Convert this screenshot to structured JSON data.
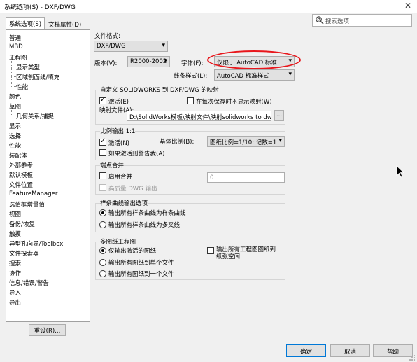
{
  "window": {
    "title": "系统选项(S) - DXF/DWG",
    "close_glyph": "✕"
  },
  "tabs": [
    {
      "label": "系统选项(S)"
    },
    {
      "label": "文档属性(D)"
    }
  ],
  "search": {
    "placeholder": "搜索选项"
  },
  "tree": [
    {
      "label": "普通"
    },
    {
      "label": "MBD"
    },
    {
      "label": "工程图"
    },
    {
      "label": "显示类型"
    },
    {
      "label": "区域剖面线/填充"
    },
    {
      "label": "性能"
    },
    {
      "label": "颜色"
    },
    {
      "label": "草图"
    },
    {
      "label": "几何关系/捕捉"
    },
    {
      "label": "显示"
    },
    {
      "label": "选择"
    },
    {
      "label": "性能"
    },
    {
      "label": "装配体"
    },
    {
      "label": "外部参考"
    },
    {
      "label": "默认模板"
    },
    {
      "label": "文件位置"
    },
    {
      "label": "FeatureManager"
    },
    {
      "label": "选值框增量值"
    },
    {
      "label": "视图"
    },
    {
      "label": "备份/恢复"
    },
    {
      "label": "触摸"
    },
    {
      "label": "异型孔向导/Toolbox"
    },
    {
      "label": "文件探索器"
    },
    {
      "label": "搜索"
    },
    {
      "label": "协作"
    },
    {
      "label": "信息/错误/警告"
    },
    {
      "label": "导入"
    },
    {
      "label": "导出"
    }
  ],
  "reset_button": "重设(R)...",
  "file_format": {
    "label": "文件格式:",
    "value": "DXF/DWG"
  },
  "version": {
    "label": "版本(V):",
    "value": "R2000-2002"
  },
  "font": {
    "label": "字体(F):",
    "value": "仅限于 AutoCAD 标准"
  },
  "line_style": {
    "label": "线条样式(L):",
    "value": "AutoCAD 标准样式"
  },
  "mapping": {
    "title": "自定义 SOLIDWORKS 到 DXF/DWG 的映射",
    "activate_label": "激活(E)",
    "activate_checked": true,
    "no_show_label": "在每次保存时不显示映射(W)",
    "no_show_checked": false,
    "file_label": "映射文件(A):",
    "file_value": "D:\\SolidWorks模板\\映射文件\\映射solidworks to dwg",
    "browse": "..."
  },
  "scale": {
    "title": "比例输出 1:1",
    "activate_label": "激活(N)",
    "activate_checked": true,
    "base_scale_label": "基体比例(B):",
    "base_scale_value": "图纸比例=1/10: 记数=1",
    "warn_label": "如果激活则警告我(A)",
    "warn_checked": false
  },
  "endpoint": {
    "title": "端点合并",
    "enable_label": "启用合并",
    "enable_checked": false,
    "value": "0",
    "hq_label": "高质量 DWG 输出",
    "hq_checked": false
  },
  "spline": {
    "title": "样条曲线输出选项",
    "options": [
      "输出所有样条曲线为样条曲线",
      "输出所有样条曲线为多叉线"
    ],
    "selected": 0
  },
  "multisheet": {
    "title": "多图纸工程图",
    "options": [
      "仅输出激活的图纸",
      "输出所有图纸到单个文件",
      "输出所有图纸到一个文件"
    ],
    "selected": 0,
    "paper_space_label": "输出所有工程图图纸到\n纸张空间",
    "paper_space_checked": false
  },
  "footer": {
    "ok": "确定",
    "cancel": "取消",
    "help": "帮助"
  },
  "colors": {
    "highlight": "#e8161b",
    "accent": "#0078d7"
  }
}
